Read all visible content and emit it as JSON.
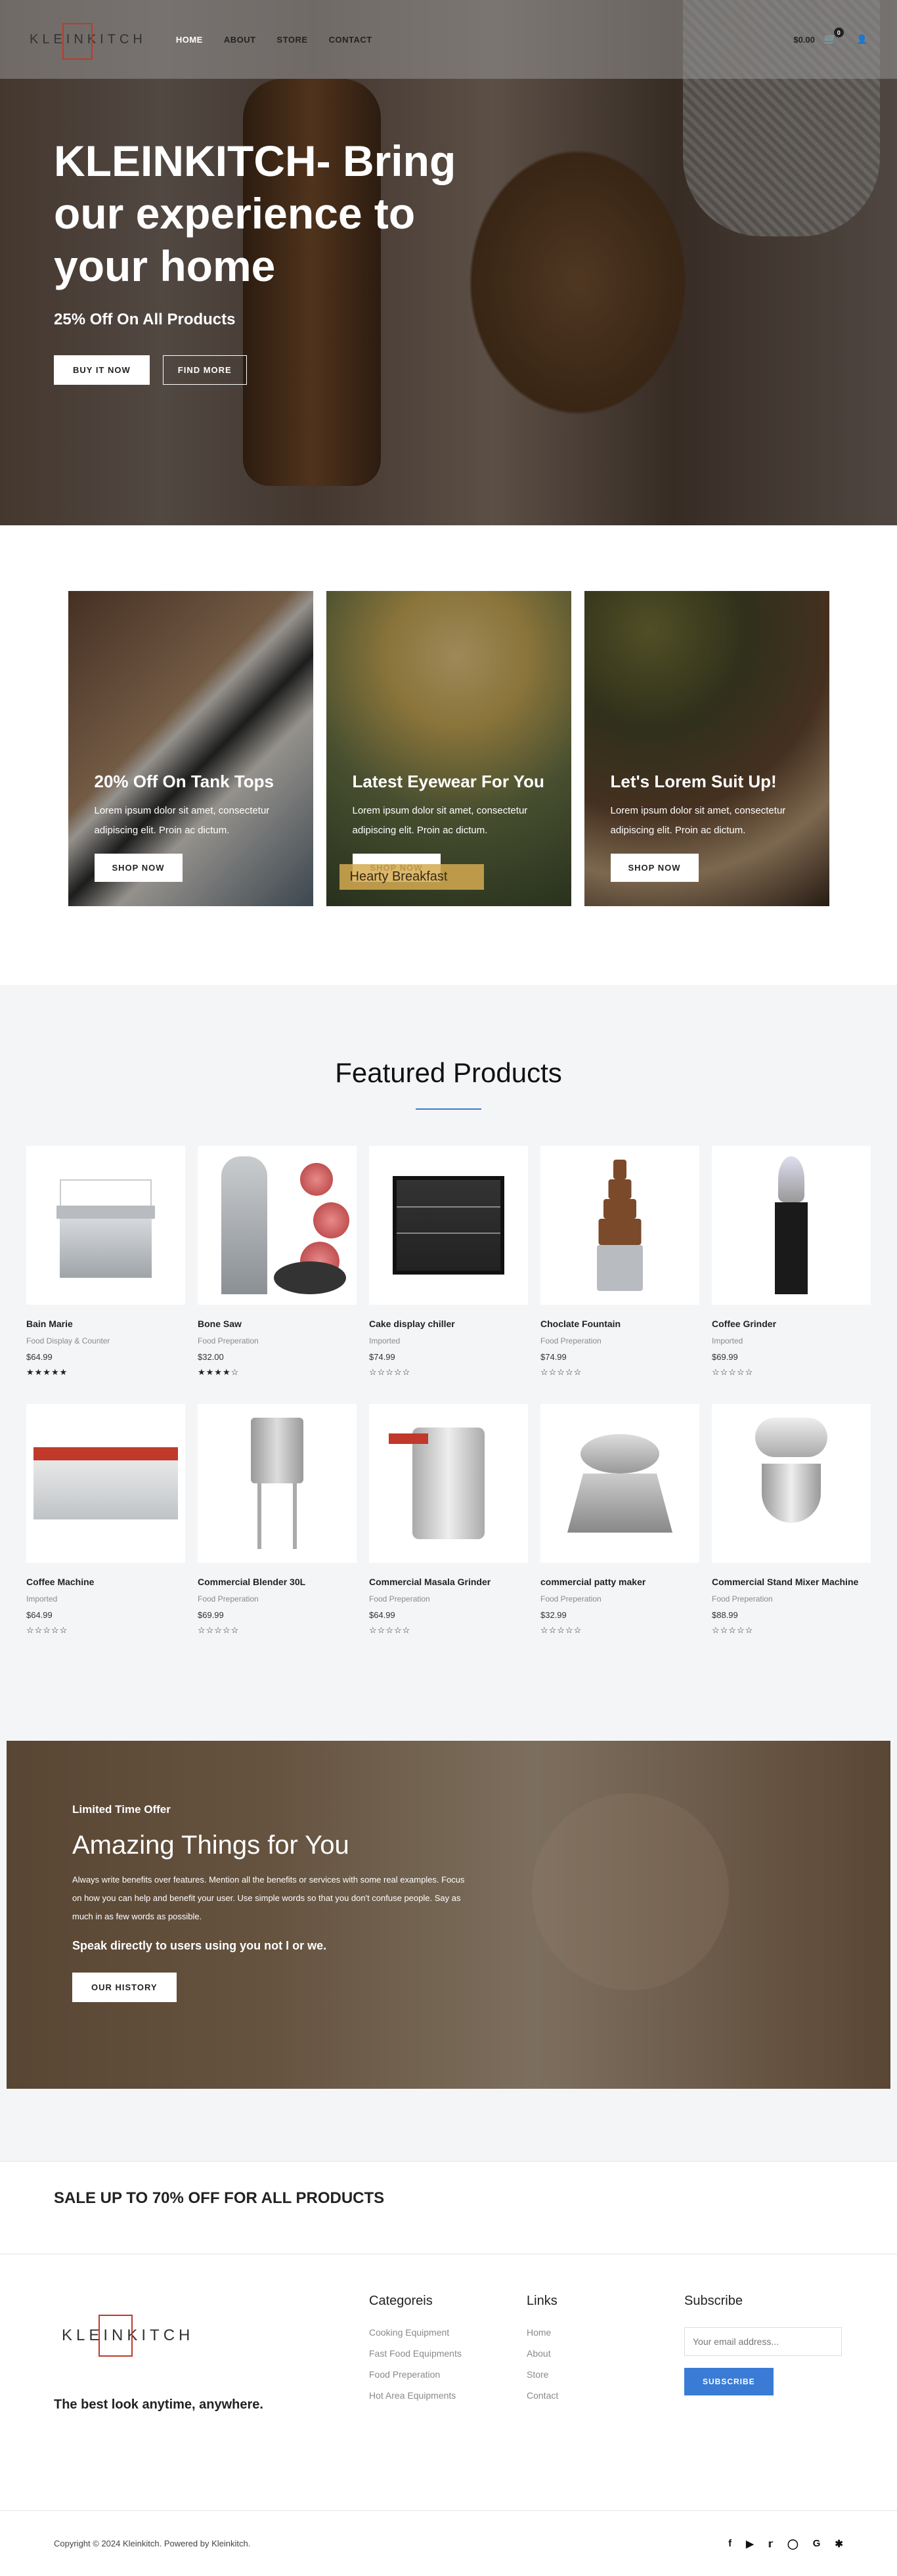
{
  "header": {
    "logo": "KLEINKITCH",
    "nav": [
      "HOME",
      "ABOUT",
      "STORE",
      "CONTACT"
    ],
    "cart_total": "$0.00",
    "cart_count": "0"
  },
  "hero": {
    "title": "KLEINKITCH- Bring our experience to your home",
    "subtitle": "25% Off On All Products",
    "btn_primary": "BUY IT NOW",
    "btn_secondary": "FIND MORE"
  },
  "promos": [
    {
      "title": "20% Off On Tank Tops",
      "text": "Lorem ipsum dolor sit amet, consectetur adipiscing elit. Proin ac dictum.",
      "btn": "SHOP NOW"
    },
    {
      "title": "Latest Eyewear For You",
      "text": "Lorem ipsum dolor sit amet, consectetur adipiscing elit. Proin ac dictum.",
      "btn": "SHOP NOW",
      "overlay": "Hearty Breakfast"
    },
    {
      "title": "Let's Lorem Suit Up!",
      "text": "Lorem ipsum dolor sit amet, consectetur adipiscing elit. Proin ac dictum.",
      "btn": "SHOP NOW"
    }
  ],
  "featured": {
    "title": "Featured Products",
    "products": [
      {
        "name": "Bain Marie",
        "category": "Food Display & Counter",
        "price": "$64.99",
        "stars": "★★★★★"
      },
      {
        "name": "Bone Saw",
        "category": "Food Preperation",
        "price": "$32.00",
        "stars": "★★★★☆"
      },
      {
        "name": "Cake display chiller",
        "category": "Imported",
        "price": "$74.99",
        "stars": "☆☆☆☆☆"
      },
      {
        "name": "Choclate Fountain",
        "category": "Food Preperation",
        "price": "$74.99",
        "stars": "☆☆☆☆☆"
      },
      {
        "name": "Coffee Grinder",
        "category": "Imported",
        "price": "$69.99",
        "stars": "☆☆☆☆☆"
      },
      {
        "name": "Coffee Machine",
        "category": "Imported",
        "price": "$64.99",
        "stars": "☆☆☆☆☆"
      },
      {
        "name": "Commercial Blender 30L",
        "category": "Food Preperation",
        "price": "$69.99",
        "stars": "☆☆☆☆☆"
      },
      {
        "name": "Commercial Masala Grinder",
        "category": "Food Preperation",
        "price": "$64.99",
        "stars": "☆☆☆☆☆"
      },
      {
        "name": "commercial patty maker",
        "category": "Food Preperation",
        "price": "$32.99",
        "stars": "☆☆☆☆☆"
      },
      {
        "name": "Commercial Stand Mixer Machine",
        "category": "Food Preperation",
        "price": "$88.99",
        "stars": "☆☆☆☆☆"
      }
    ]
  },
  "limited": {
    "tag": "Limited Time Offer",
    "title": "Amazing Things for You",
    "text": "Always write benefits over features. Mention all the benefits or services with some real examples. Focus on how you can help and benefit your user. Use simple words so that you don't confuse people. Say as much in as few words as possible.",
    "speak": "Speak directly to users using you not I or we.",
    "btn": "OUR HISTORY"
  },
  "sale": {
    "text": "SALE UP TO 70% OFF FOR ALL PRODUCTS"
  },
  "footer": {
    "logo": "KLEINKITCH",
    "tagline": "The best look anytime, anywhere.",
    "categories_title": "Categoreis",
    "categories": [
      "Cooking Equipment",
      "Fast Food Equipments",
      "Food Preperation",
      "Hot Area Equipments"
    ],
    "links_title": "Links",
    "links": [
      "Home",
      "About",
      "Store",
      "Contact"
    ],
    "subscribe_title": "Subscribe",
    "email_placeholder": "Your email address...",
    "subscribe_btn": "SUBSCRIBE",
    "copyright": "Copyright © 2024 Kleinkitch. Powered by Kleinkitch.",
    "social_icons": [
      "facebook-icon",
      "youtube-icon",
      "twitter-icon",
      "instagram-icon",
      "google-icon",
      "yelp-icon"
    ]
  },
  "colors": {
    "accent": "#3a7bd5",
    "logo_box": "#c0392b"
  }
}
